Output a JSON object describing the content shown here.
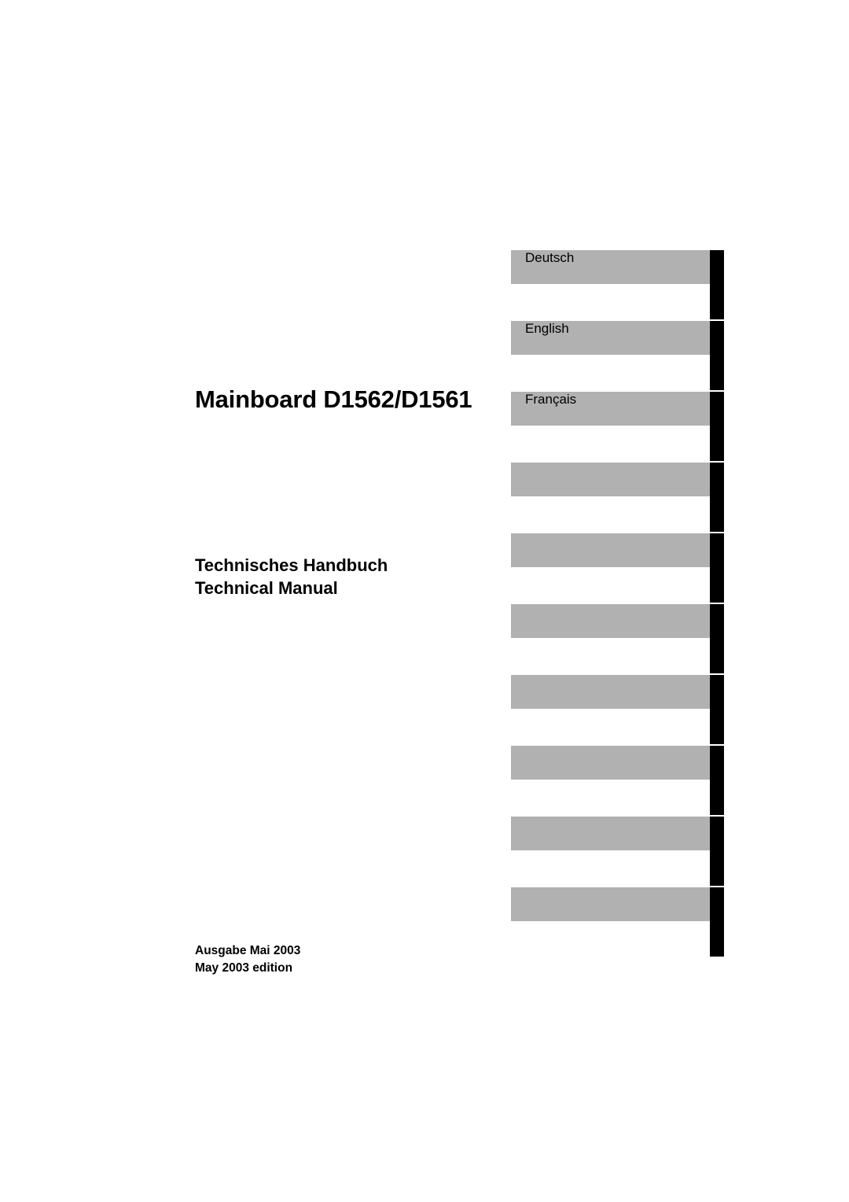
{
  "title": "Mainboard D1562/D1561",
  "subtitle": {
    "line1": "Technisches Handbuch",
    "line2": "Technical Manual"
  },
  "edition": {
    "line1": "Ausgabe Mai 2003",
    "line2": "May 2003 edition"
  },
  "tabs": [
    {
      "label": "Deutsch"
    },
    {
      "label": "English"
    },
    {
      "label": "Français"
    },
    {
      "label": ""
    },
    {
      "label": ""
    },
    {
      "label": ""
    },
    {
      "label": ""
    },
    {
      "label": ""
    },
    {
      "label": ""
    },
    {
      "label": ""
    }
  ],
  "colors": {
    "tab_bar": "#b1b1b1",
    "tab_edge": "#000000"
  }
}
